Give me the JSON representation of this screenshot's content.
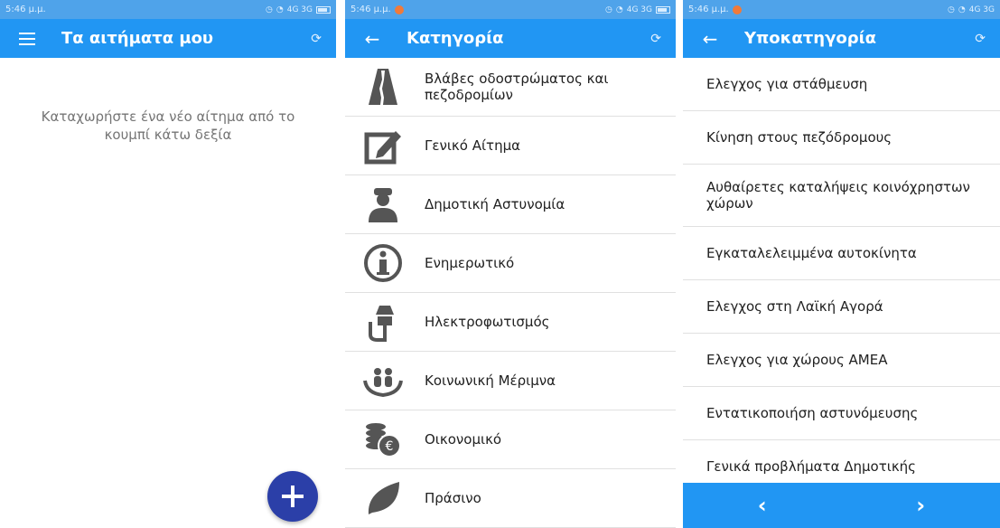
{
  "screens": [
    {
      "status": {
        "time": "5:46 μ.μ.",
        "network": "4G 3G"
      },
      "appbar": {
        "title": "Τα αιτήματα μου",
        "nav_icon": "menu-icon",
        "action_icon": "refresh-icon"
      },
      "empty_message": "Καταχωρήστε ένα νέο αίτημα από το κουμπί κάτω δεξία",
      "fab": {
        "icon": "plus-icon"
      }
    },
    {
      "status": {
        "time": "5:46 μ.μ.",
        "network": "4G 3G"
      },
      "appbar": {
        "title": "Κατηγορία",
        "nav_icon": "back-arrow-icon",
        "action_icon": "refresh-icon"
      },
      "categories": [
        {
          "label": "Βλάβες οδοστρώματος και πεζοδρομίων",
          "icon": "road-icon"
        },
        {
          "label": "Γενικό Αίτημα",
          "icon": "edit-icon"
        },
        {
          "label": "Δημοτική Αστυνομία",
          "icon": "police-icon"
        },
        {
          "label": "Ενημερωτικό",
          "icon": "info-icon"
        },
        {
          "label": "Ηλεκτροφωτισμός",
          "icon": "street-lamp-icon"
        },
        {
          "label": "Κοινωνική Μέριμνα",
          "icon": "social-care-icon"
        },
        {
          "label": "Οικονομικό",
          "icon": "coins-euro-icon"
        },
        {
          "label": "Πράσινο",
          "icon": "leaf-icon"
        }
      ]
    },
    {
      "status": {
        "time": "5:46 μ.μ.",
        "network": "4G 3G"
      },
      "appbar": {
        "title": "Υποκατηγορία",
        "nav_icon": "back-arrow-icon",
        "action_icon": "refresh-icon"
      },
      "subcategories": [
        "Ελεγχος για στάθμευση",
        "Κίνηση στους πεζόδρομους",
        "Αυθαίρετες καταλήψεις κοινόχρηστων χώρων",
        "Εγκαταλελειμμένα αυτοκίνητα",
        "Ελεγχος στη Λαϊκή Αγορά",
        "Ελεγχος για χώρους ΑΜΕΑ",
        "Εντατικοποιήση αστυνόμευσης",
        "Γενικά προβλήματα Δημοτικής"
      ],
      "bottom_nav": {
        "prev": "‹",
        "next": "›"
      }
    }
  ],
  "colors": {
    "appbar": "#2196f3",
    "statusbar": "#4fa3ea",
    "fab": "#2b3fa8",
    "icon_gray": "#555555"
  }
}
